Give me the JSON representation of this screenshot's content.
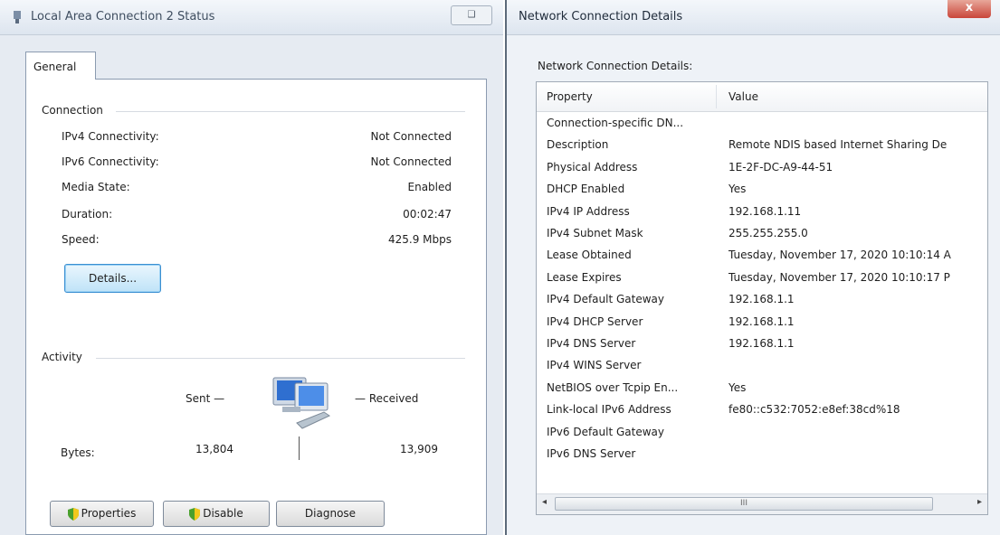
{
  "status_window": {
    "title": "Local Area Connection 2 Status",
    "max_glyph": "❑",
    "tab_general": "General",
    "connection": {
      "heading": "Connection",
      "rows": [
        {
          "label": "IPv4 Connectivity:",
          "value": "Not Connected"
        },
        {
          "label": "IPv6 Connectivity:",
          "value": "Not Connected"
        },
        {
          "label": "Media State:",
          "value": "Enabled"
        },
        {
          "label": "Duration:",
          "value": "00:02:47"
        },
        {
          "label": "Speed:",
          "value": "425.9 Mbps"
        }
      ],
      "details_button": "Details..."
    },
    "activity": {
      "heading": "Activity",
      "sent_label": "Sent —",
      "received_label": "—   Received",
      "bytes_label": "Bytes:",
      "bytes_sent": "13,804",
      "bytes_received": "13,909"
    },
    "buttons": {
      "properties": "Properties",
      "disable": "Disable",
      "diagnose": "Diagnose"
    }
  },
  "details_window": {
    "title": "Network Connection Details",
    "close_glyph": "x",
    "caption": "Network Connection Details:",
    "columns": {
      "property": "Property",
      "value": "Value"
    },
    "rows": [
      {
        "property": "Connection-specific DN...",
        "value": ""
      },
      {
        "property": "Description",
        "value": "Remote NDIS based Internet Sharing De"
      },
      {
        "property": "Physical Address",
        "value": "1E-2F-DC-A9-44-51"
      },
      {
        "property": "DHCP Enabled",
        "value": "Yes"
      },
      {
        "property": "IPv4 IP Address",
        "value": "192.168.1.11"
      },
      {
        "property": "IPv4 Subnet Mask",
        "value": "255.255.255.0"
      },
      {
        "property": "Lease Obtained",
        "value": "Tuesday, November 17, 2020 10:10:14 A"
      },
      {
        "property": "Lease Expires",
        "value": "Tuesday, November 17, 2020 10:10:17 P"
      },
      {
        "property": "IPv4 Default Gateway",
        "value": "192.168.1.1"
      },
      {
        "property": "IPv4 DHCP Server",
        "value": "192.168.1.1"
      },
      {
        "property": "IPv4 DNS Server",
        "value": "192.168.1.1"
      },
      {
        "property": "IPv4 WINS Server",
        "value": ""
      },
      {
        "property": "NetBIOS over Tcpip En...",
        "value": "Yes"
      },
      {
        "property": "Link-local IPv6 Address",
        "value": "fe80::c532:7052:e8ef:38cd%18"
      },
      {
        "property": "IPv6 Default Gateway",
        "value": ""
      },
      {
        "property": "IPv6 DNS Server",
        "value": ""
      }
    ],
    "scroll_left": "◂",
    "scroll_right": "▸",
    "scroll_grip": "III"
  },
  "colors": {
    "accent_blue": "#3b8fd1",
    "close_red": "#c9463a",
    "window_frame": "#e6ebf2"
  },
  "icons": [
    "window-icon",
    "network-computers-icon",
    "uac-shield-icon"
  ]
}
